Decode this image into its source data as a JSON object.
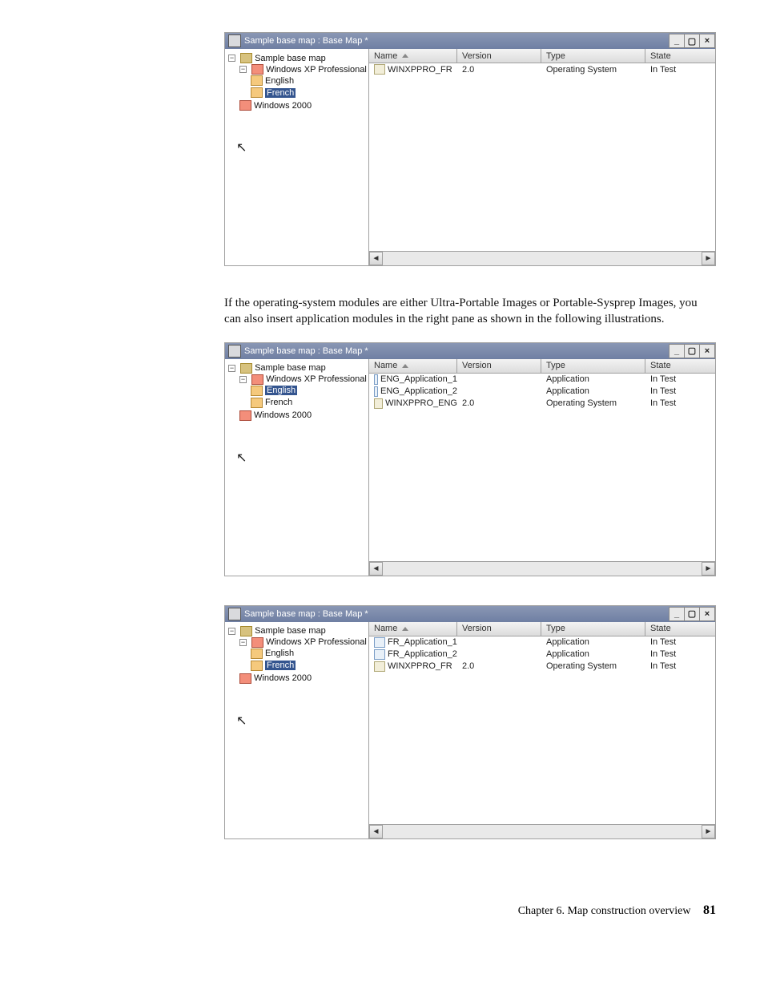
{
  "paragraph": "If the operating-system modules are either Ultra-Portable Images or Portable-Sysprep Images, you can also insert application modules in the right pane as shown in the following illustrations.",
  "footer": {
    "chapter": "Chapter 6. Map construction overview",
    "page": "81"
  },
  "common_title": "Sample base map : Base Map *",
  "cols": {
    "name": "Name",
    "version": "Version",
    "type": "Type",
    "state": "State"
  },
  "tree_common": {
    "root": "Sample base map",
    "os1": "Windows XP Professional",
    "leaf_en": "English",
    "leaf_fr": "French",
    "os2": "Windows 2000"
  },
  "win1": {
    "selected": "French",
    "rows": [
      {
        "icon": "osr",
        "name": "WINXPPRO_FR",
        "version": "2.0",
        "type": "Operating System",
        "state": "In Test"
      }
    ]
  },
  "win2": {
    "selected": "English",
    "rows": [
      {
        "icon": "app",
        "name": "ENG_Application_1",
        "version": "",
        "type": "Application",
        "state": "In Test"
      },
      {
        "icon": "app",
        "name": "ENG_Application_2",
        "version": "",
        "type": "Application",
        "state": "In Test"
      },
      {
        "icon": "osr",
        "name": "WINXPPRO_ENG",
        "version": "2.0",
        "type": "Operating System",
        "state": "In Test"
      }
    ]
  },
  "win3": {
    "selected": "French",
    "rows": [
      {
        "icon": "app",
        "name": "FR_Application_1",
        "version": "",
        "type": "Application",
        "state": "In Test"
      },
      {
        "icon": "app",
        "name": "FR_Application_2",
        "version": "",
        "type": "Application",
        "state": "In Test"
      },
      {
        "icon": "osr",
        "name": "WINXPPRO_FR",
        "version": "2.0",
        "type": "Operating System",
        "state": "In Test"
      }
    ]
  }
}
